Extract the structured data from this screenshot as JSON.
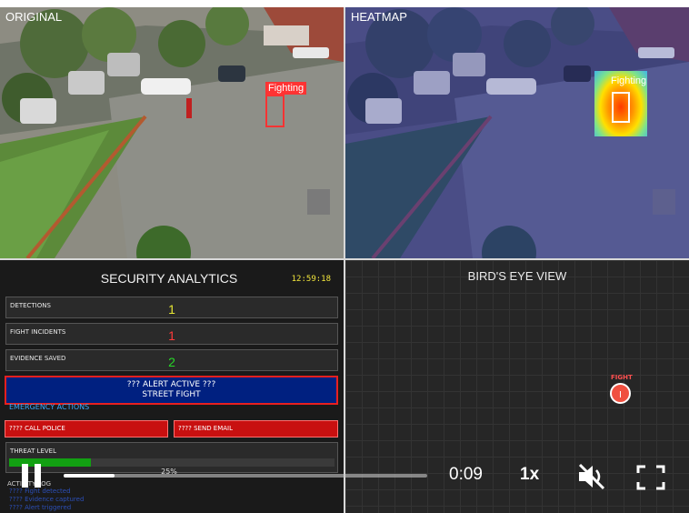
{
  "quadrants": {
    "original_label": "ORIGINAL",
    "heatmap_label": "HEATMAP"
  },
  "detection": {
    "label": "Fighting",
    "box_color": "#ff3333"
  },
  "analytics": {
    "title": "SECURITY ANALYTICS",
    "clock": "12:59:18",
    "stats": [
      {
        "label": "DETECTIONS",
        "value": "1",
        "color": "#e6e633"
      },
      {
        "label": "FIGHT INCIDENTS",
        "value": "1",
        "color": "#ff3b3b"
      },
      {
        "label": "EVIDENCE SAVED",
        "value": "2",
        "color": "#27d827"
      }
    ],
    "alert": {
      "line1": "??? ALERT ACTIVE ???",
      "line2": "STREET FIGHT"
    },
    "emergency_heading": "EMERGENCY ACTIONS",
    "call_police": "???? CALL POLICE",
    "send_email": "???? SEND EMAIL",
    "threat_label": "THREAT LEVEL",
    "threat_percent_text": "25%",
    "threat_level": 0.25,
    "activity_title": "ACTIVITY LOG",
    "activity": [
      "???? Fight detected",
      "???? Evidence captured",
      "???? Alert triggered"
    ]
  },
  "birdseye": {
    "title": "BIRD'S EYE VIEW",
    "marker_label": "FIGHT"
  },
  "player": {
    "time": "0:09",
    "speed": "1x",
    "progress": 0.14,
    "icons": {
      "pause": "pause-icon",
      "mute": "volume-muted-icon",
      "fullscreen": "fullscreen-icon"
    }
  }
}
